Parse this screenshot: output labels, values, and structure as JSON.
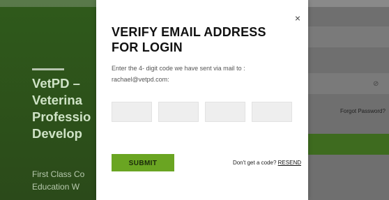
{
  "background": {
    "hero_title": "VetPD –\nVeterina\nProfessio\nDevelop",
    "hero_subtitle": "First Class Co\nEducation W",
    "forgot_password": "Forgot Password?",
    "eye_icon": "eye-slash-icon",
    "colors": {
      "green_panel": "#2f5a1b",
      "green_button": "#3e6b1f"
    }
  },
  "modal": {
    "title": "VERIFY EMAIL ADDRESS FOR LOGIN",
    "description": "Enter the 4- digit code we have sent via mail to :",
    "email": "rachael@vetpd.com:",
    "code_inputs": [
      {
        "value": "",
        "placeholder": ""
      },
      {
        "value": "",
        "placeholder": ""
      },
      {
        "value": "",
        "placeholder": ""
      },
      {
        "value": "",
        "placeholder": ""
      }
    ],
    "submit_label": "SUBMIT",
    "resend_prompt": "Don't get a code?",
    "resend_label": "RESEND",
    "close_icon": "close-icon",
    "colors": {
      "submit_bg": "#6aa522"
    }
  }
}
